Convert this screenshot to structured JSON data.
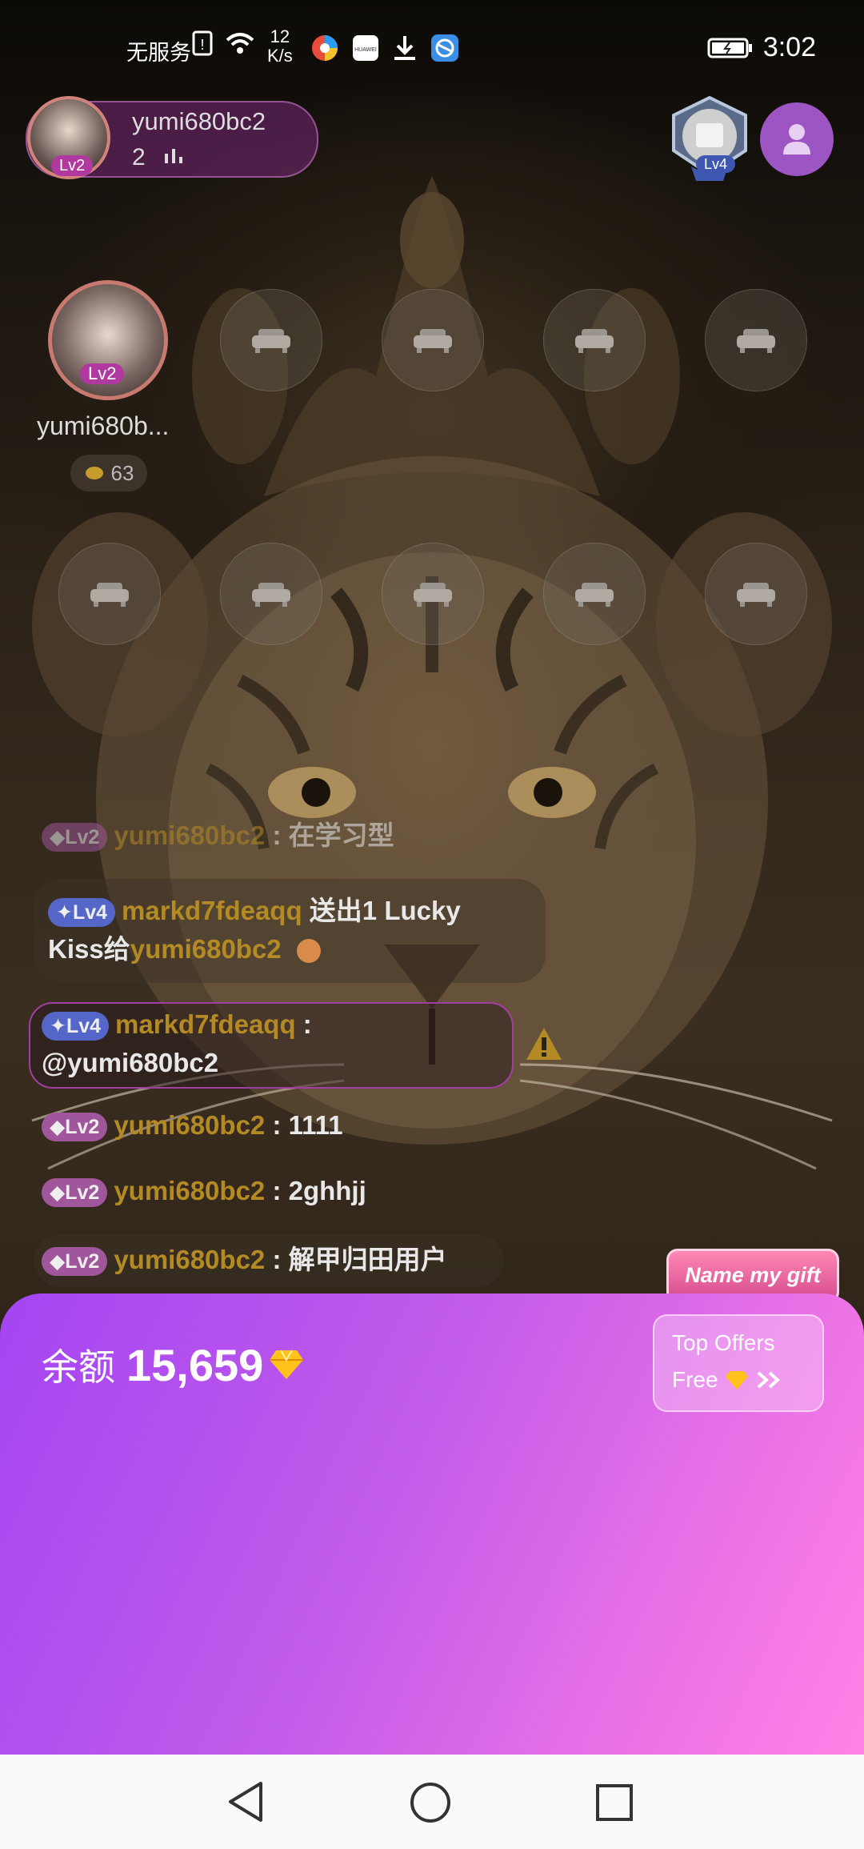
{
  "status_bar": {
    "carrier": "无服务",
    "net_speed_value": "12",
    "net_speed_unit": "K/s",
    "time": "3:02"
  },
  "host": {
    "name": "yumi680bc2",
    "listener_count": "2",
    "level": "Lv2"
  },
  "top_right": {
    "medal_level": "Lv4"
  },
  "seats": {
    "host_seat_name": "yumi680b...",
    "host_seat_level": "Lv2",
    "host_seat_coins": "63"
  },
  "chat": [
    {
      "level": "Lv2",
      "user": "yumi680bc2",
      "sep": " : ",
      "text": "在学习型"
    },
    {
      "level": "Lv4",
      "user": "markd7fdeaqq",
      "text_a": " 送出1 Lucky",
      "text_b": "Kiss给",
      "target": "yumi680bc2"
    },
    {
      "level": "Lv4",
      "user": "markd7fdeaqq",
      "sep": " : ",
      "text": "@yumi680bc2"
    },
    {
      "level": "Lv2",
      "user": "yumi680bc2",
      "sep": " : ",
      "text": "1111"
    },
    {
      "level": "Lv2",
      "user": "yumi680bc2",
      "sep": " : ",
      "text": "2ghhjj"
    },
    {
      "level": "Lv2",
      "user": "yumi680bc2",
      "sep": " : ",
      "text": "解甲归田用户"
    }
  ],
  "name_my_gift": "Name my gift",
  "wallet": {
    "balance_label": "余额",
    "balance_value": "15,659"
  },
  "offers": {
    "line1": "Top Offers",
    "line2": "Free"
  },
  "colors": {
    "panel_start": "#a445f2",
    "panel_end": "#ff82e6",
    "username_gold": "#b48a25",
    "lv2_badge": "#a0569a",
    "lv4_badge": "#5466c8"
  },
  "icons": [
    "sim-icon",
    "wifi-icon",
    "browser-icon",
    "huawei-icon",
    "download-icon",
    "app-icon",
    "battery-icon",
    "sofa-icon",
    "diamond-icon",
    "warning-icon",
    "back-icon",
    "home-icon",
    "recents-icon"
  ]
}
